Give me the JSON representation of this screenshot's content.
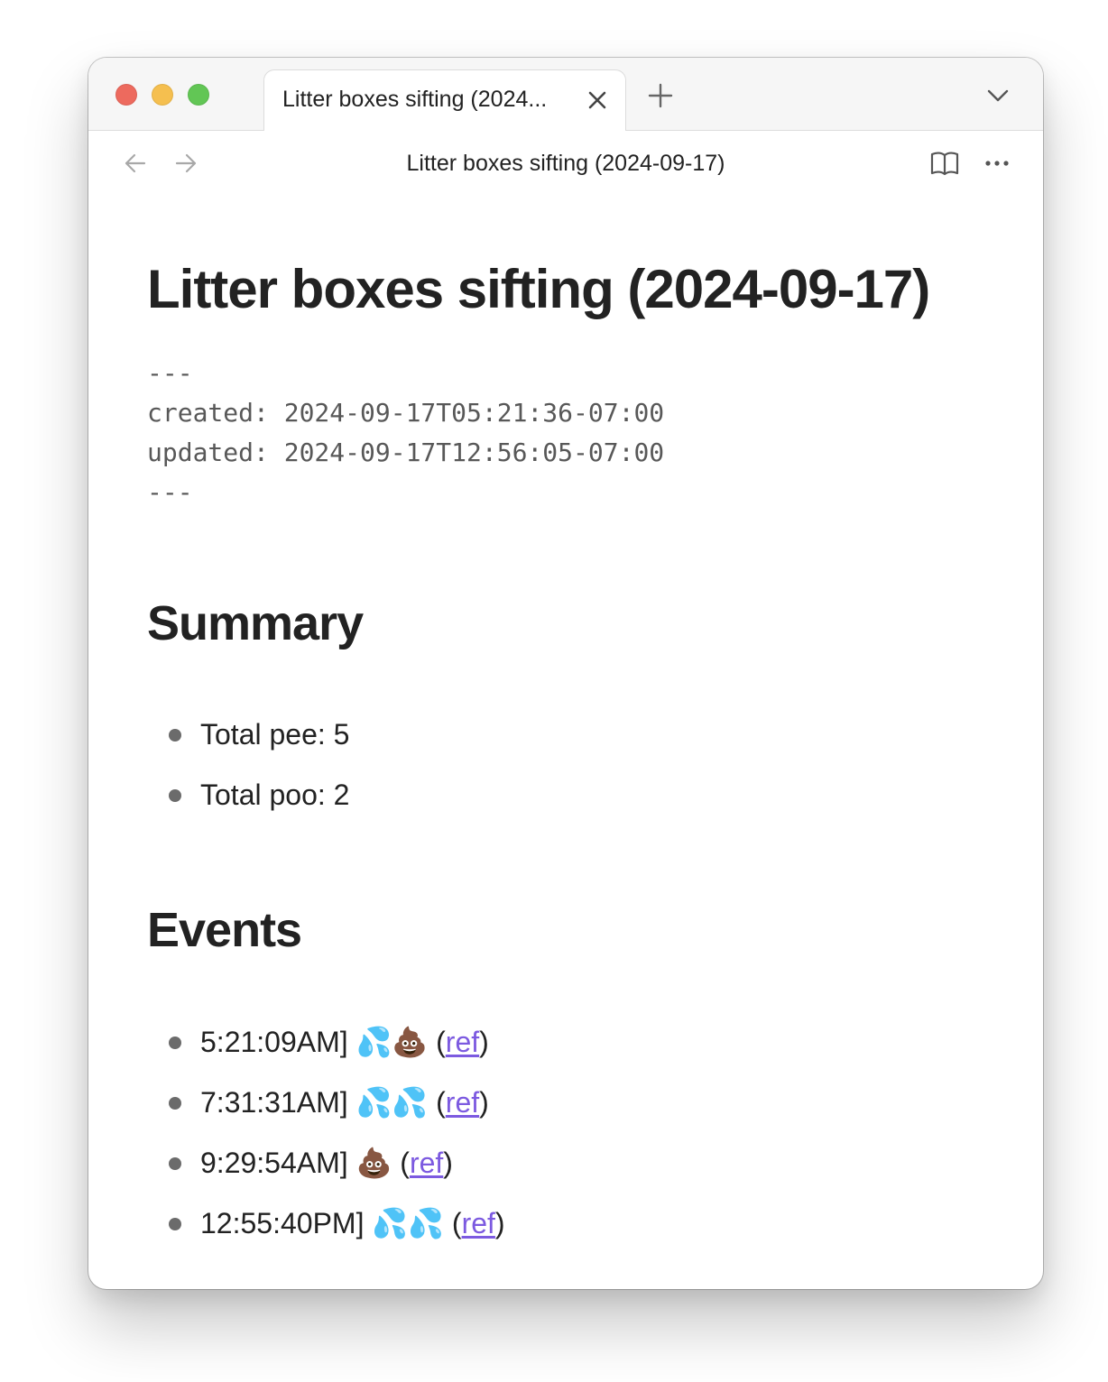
{
  "window": {
    "tab_title": "Litter boxes sifting (2024...",
    "nav_title": "Litter boxes sifting (2024-09-17)"
  },
  "icons": {
    "tab_close": "close-icon",
    "new_tab": "plus-icon",
    "tab_list": "chevron-down-icon",
    "back": "arrow-left-icon",
    "forward": "arrow-right-icon",
    "reading_view": "book-open-icon",
    "more": "more-options-icon"
  },
  "colors": {
    "link": "#7c5ae0",
    "traffic_close": "#ed6a5e",
    "traffic_minimize": "#f5bf4f",
    "traffic_maximize": "#62c655"
  },
  "document": {
    "title": "Litter boxes sifting (2024-09-17)",
    "frontmatter": {
      "open_delim": "---",
      "created_line": "created: 2024-09-17T05:21:36-07:00",
      "updated_line": "updated: 2024-09-17T12:56:05-07:00",
      "close_delim": "---"
    },
    "summary": {
      "heading": "Summary",
      "items": [
        "Total pee: 5",
        "Total poo: 2"
      ]
    },
    "events": {
      "heading": "Events",
      "items": [
        {
          "time": "5:21:09AM]",
          "emoji": "💦💩",
          "link": "ref"
        },
        {
          "time": "7:31:31AM]",
          "emoji": "💦💦",
          "link": "ref"
        },
        {
          "time": "9:29:54AM]",
          "emoji": "💩",
          "link": "ref"
        },
        {
          "time": "12:55:40PM]",
          "emoji": "💦💦",
          "link": "ref"
        }
      ]
    }
  }
}
